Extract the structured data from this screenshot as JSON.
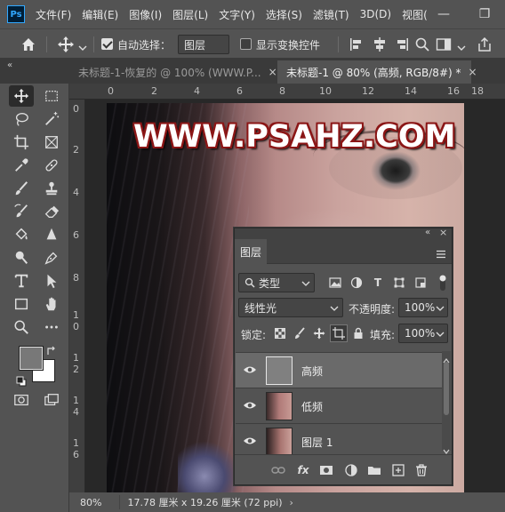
{
  "menubar": {
    "logo": "Ps",
    "items": [
      "文件(F)",
      "编辑(E)",
      "图像(I)",
      "图层(L)",
      "文字(Y)",
      "选择(S)",
      "滤镜(T)",
      "3D(D)",
      "视图("
    ],
    "window_buttons": {
      "minimize": "—",
      "restore": "❐"
    }
  },
  "options": {
    "auto_select_label": "自动选择：",
    "auto_select_checked": true,
    "auto_select_target": "图层",
    "show_transform_label": "显示变换控件",
    "show_transform_checked": false
  },
  "tabs": [
    {
      "label": "未标题-1-恢复的 @ 100% (WWW.P...",
      "close": "×",
      "active": false
    },
    {
      "label": "未标题-1 @ 80% (高频, RGB/8#) *",
      "close": "×",
      "active": true
    }
  ],
  "rulers": {
    "top": [
      "0",
      "2",
      "4",
      "6",
      "8",
      "10",
      "12",
      "14",
      "16",
      "18"
    ],
    "left": [
      "0",
      "2",
      "4",
      "6",
      "8",
      "1\n0",
      "1\n2",
      "1\n4",
      "1\n6"
    ]
  },
  "canvas": {
    "watermark": "WWW.PSAHZ.COM"
  },
  "layers_panel": {
    "tab": "图层",
    "filter_kind": "类型",
    "blend_mode": "线性光",
    "opacity_label": "不透明度:",
    "opacity": "100%",
    "lock_label": "锁定:",
    "fill_label": "填充:",
    "fill": "100%",
    "layers": [
      {
        "name": "高频",
        "selected": true,
        "thumb_color": "#808080"
      },
      {
        "name": "低频",
        "selected": false,
        "thumb_color": "#b07a78"
      },
      {
        "name": "图层 1",
        "selected": false,
        "thumb_color": "#a87470"
      }
    ]
  },
  "colors": {
    "foreground": "#787878",
    "background": "#ffffff",
    "watermark_outline": "#8b1616"
  },
  "status": {
    "zoom": "80%",
    "doc_size": "17.78 厘米 x 19.26 厘米 (72 ppi)"
  }
}
